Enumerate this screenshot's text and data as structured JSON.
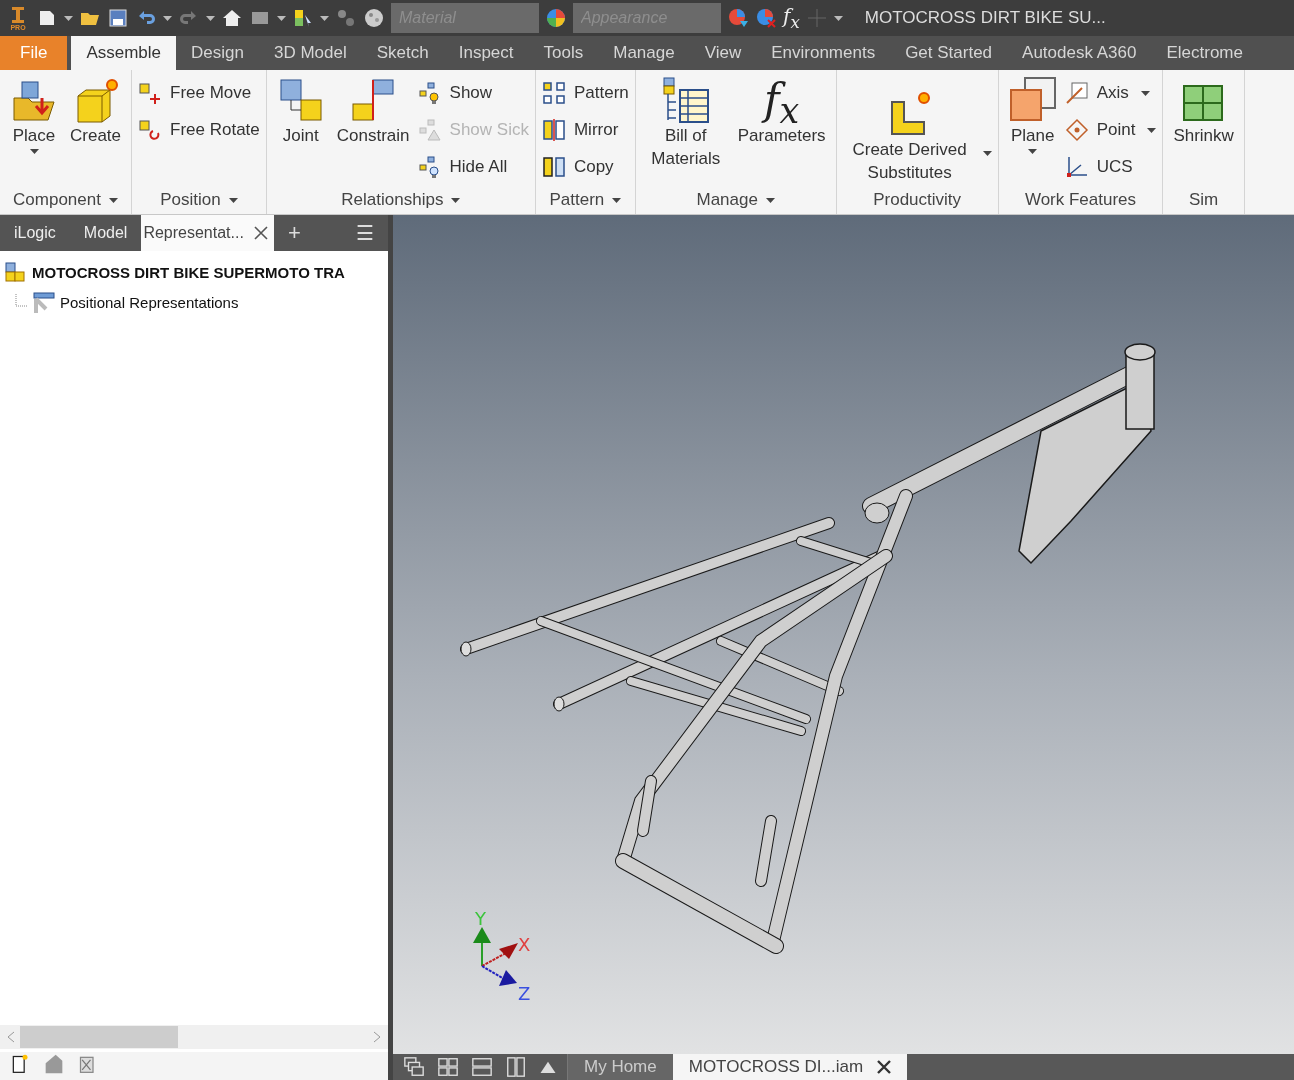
{
  "quick_access": {
    "logo_badge": "PRO",
    "material": {
      "placeholder": "Material"
    },
    "appearance": {
      "placeholder": "Appearance"
    },
    "fx_glyph": "f$_{x}$",
    "title": "MOTOCROSS DIRT BIKE SU..."
  },
  "ribbon_tabs": [
    {
      "label": "File",
      "kind": "file",
      "selected": false
    },
    {
      "label": "Assemble",
      "kind": "tab",
      "selected": true
    },
    {
      "label": "Design",
      "kind": "tab",
      "selected": false
    },
    {
      "label": "3D Model",
      "kind": "tab",
      "selected": false
    },
    {
      "label": "Sketch",
      "kind": "tab",
      "selected": false
    },
    {
      "label": "Inspect",
      "kind": "tab",
      "selected": false
    },
    {
      "label": "Tools",
      "kind": "tab",
      "selected": false
    },
    {
      "label": "Manage",
      "kind": "tab",
      "selected": false
    },
    {
      "label": "View",
      "kind": "tab",
      "selected": false
    },
    {
      "label": "Environments",
      "kind": "tab",
      "selected": false
    },
    {
      "label": "Get Started",
      "kind": "tab",
      "selected": false
    },
    {
      "label": "Autodesk A360",
      "kind": "tab",
      "selected": false
    },
    {
      "label": "Electrome",
      "kind": "tab",
      "selected": false
    }
  ],
  "ribbon_panels": [
    {
      "label": "Component",
      "dropdown": true,
      "buttons": [
        {
          "label": "Place",
          "kind": "large",
          "dropdown": true,
          "disabled": false
        },
        {
          "label": "Create",
          "kind": "large",
          "dropdown": false,
          "disabled": false
        }
      ]
    },
    {
      "label": "Position",
      "dropdown": true,
      "buttons": [
        {
          "label": "Free Move",
          "kind": "small",
          "dropdown": false,
          "disabled": false
        },
        {
          "label": "Free Rotate",
          "kind": "small",
          "dropdown": false,
          "disabled": false
        }
      ]
    },
    {
      "label": "Relationships",
      "dropdown": true,
      "buttons": [
        {
          "label": "Joint",
          "kind": "large",
          "dropdown": false,
          "disabled": false
        },
        {
          "label": "Constrain",
          "kind": "large",
          "dropdown": false,
          "disabled": false
        },
        {
          "label": "Show",
          "kind": "small",
          "dropdown": false,
          "disabled": false
        },
        {
          "label": "Show Sick",
          "kind": "small",
          "dropdown": false,
          "disabled": true
        },
        {
          "label": "Hide All",
          "kind": "small",
          "dropdown": false,
          "disabled": false
        }
      ]
    },
    {
      "label": "Pattern",
      "dropdown": true,
      "buttons": [
        {
          "label": "Pattern",
          "kind": "small",
          "dropdown": false,
          "disabled": false
        },
        {
          "label": "Mirror",
          "kind": "small",
          "dropdown": false,
          "disabled": false
        },
        {
          "label": "Copy",
          "kind": "small",
          "dropdown": false,
          "disabled": false
        }
      ]
    },
    {
      "label": "Manage",
      "dropdown": true,
      "buttons": [
        {
          "label": "Bill of Materials",
          "kind": "large",
          "dropdown": false,
          "disabled": false
        },
        {
          "label": "Parameters",
          "kind": "glyph",
          "glyph": "f$_{x}$",
          "dropdown": false,
          "disabled": false
        }
      ]
    },
    {
      "label": "Productivity",
      "dropdown": false,
      "buttons": [
        {
          "label": "Create Derived Substitutes",
          "kind": "large_side",
          "dropdown": true,
          "disabled": false
        }
      ]
    },
    {
      "label": "Work Features",
      "dropdown": false,
      "buttons": [
        {
          "label": "Plane",
          "kind": "large",
          "dropdown": true,
          "disabled": false
        },
        {
          "label": "Axis",
          "kind": "small",
          "dropdown": true,
          "disabled": false
        },
        {
          "label": "Point",
          "kind": "small",
          "dropdown": true,
          "disabled": false
        },
        {
          "label": "UCS",
          "kind": "small",
          "dropdown": false,
          "disabled": false
        }
      ]
    },
    {
      "label": "Sim",
      "dropdown": false,
      "buttons": [
        {
          "label": "Shrinkw",
          "kind": "large",
          "dropdown": false,
          "disabled": false
        }
      ]
    }
  ],
  "browser": {
    "tabs": [
      {
        "label": "iLogic",
        "selected": false,
        "closable": false
      },
      {
        "label": "Model",
        "selected": false,
        "closable": false
      },
      {
        "label": "Representat...",
        "selected": true,
        "closable": true
      }
    ],
    "add_glyph": "+",
    "menu_glyph": "☰",
    "tree": [
      {
        "label": "MOTOCROSS DIRT BIKE SUPERMOTO TRA",
        "bold": true,
        "children": [
          {
            "label": "Positional Representations",
            "bold": false
          }
        ]
      }
    ]
  },
  "viewport": {
    "triad": {
      "y": "Y",
      "x": "X",
      "z": "Z"
    }
  },
  "document_tabs": [
    {
      "label": "My Home",
      "selected": false,
      "closable": false
    },
    {
      "label": "MOTOCROSS DI...iam",
      "selected": true,
      "closable": true
    }
  ]
}
